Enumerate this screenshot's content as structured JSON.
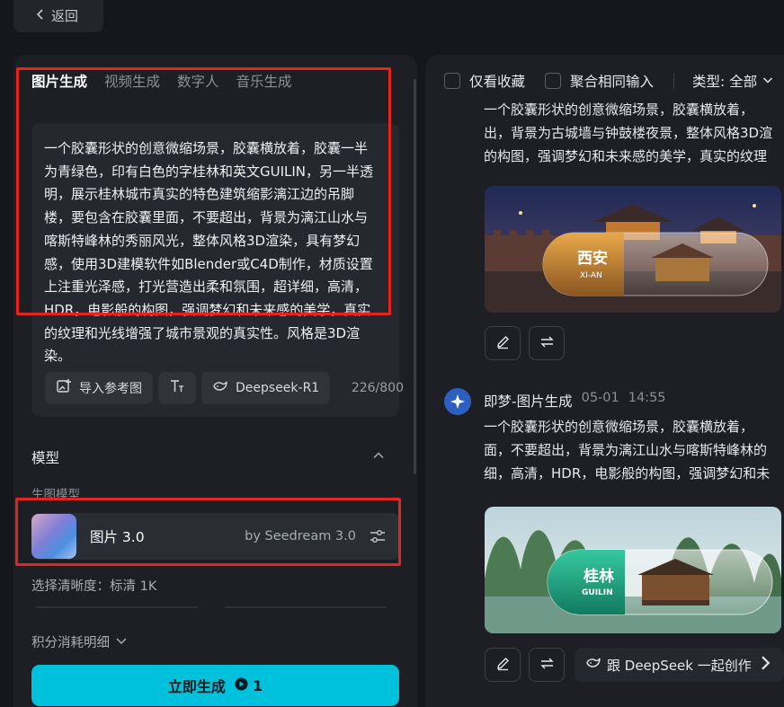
{
  "back": {
    "label": "返回"
  },
  "tabs": [
    {
      "label": "图片生成",
      "active": true
    },
    {
      "label": "视频生成",
      "active": false
    },
    {
      "label": "数字人",
      "active": false
    },
    {
      "label": "音乐生成",
      "active": false
    }
  ],
  "prompt": {
    "text": "一个胶囊形状的创意微缩场景，胶囊横放着，胶囊一半为青绿色，印有白色的字桂林和英文GUILIN，另一半透明，展示桂林城市真实的特色建筑缩影漓江边的吊脚楼，要包含在胶囊里面，不要超出，背景为漓江山水与喀斯特峰林的秀丽风光，整体风格3D渲染，具有梦幻感，使用3D建模软件如Blender或C4D制作，材质设置上注重光泽感，打光营造出柔和氛围，超详细，高清，HDR，电影般的构图，强调梦幻和未来感的美学，真实的纹理和光线增强了城市景观的真实性。风格是3D渲染。",
    "counter": "226/800",
    "tools": {
      "import_ref": "导入参考图",
      "deepseek": "Deepseek-R1"
    }
  },
  "model_section": {
    "title": "模型",
    "sub_label": "生图模型",
    "model_name": "图片 3.0",
    "model_by": "by Seedream 3.0"
  },
  "clarity": {
    "label": "选择清晰度：标清 1K"
  },
  "cost": {
    "label": "积分消耗明细"
  },
  "generate": {
    "label": "立即生成",
    "count": "1"
  },
  "filters": {
    "favorites_only": "仅看收藏",
    "merge_same": "聚合相同输入",
    "type_label": "类型: 全部"
  },
  "messages": [
    {
      "lines": [
        "一个胶囊形状的创意微缩场景，胶囊横放着，",
        "出，背景为古城墙与钟鼓楼夜景，整体风格3D渲",
        "的构图，强调梦幻和未来感的美学，真实的纹理"
      ],
      "image_label_cn": "西安",
      "image_label_en": "XI-AN"
    },
    {
      "sender": "即梦-图片生成",
      "date": "05-01",
      "time": "14:55",
      "lines": [
        "一个胶囊形状的创意微缩场景，胶囊横放着，",
        "面，不要超出，背景为漓江山水与喀斯特峰林的",
        "细，高清，HDR，电影般的构图，强调梦幻和未"
      ],
      "image_label_cn": "桂林",
      "image_label_en": "GUILIN",
      "deepseek_label": "跟 DeepSeek 一起创作"
    }
  ],
  "colors": {
    "accent": "#00c1dc",
    "highlight_border": "#e8231d",
    "background": "#15171c",
    "panel": "#1d1f25"
  },
  "icons": [
    "chevron-left-icon",
    "import-image-icon",
    "text-format-icon",
    "deepseek-whale-icon",
    "chevron-up-icon",
    "settings-sliders-icon",
    "chevron-down-icon",
    "coin-icon",
    "edit-icon",
    "regenerate-icon",
    "chevron-right-icon",
    "jimeng-logo-icon"
  ]
}
